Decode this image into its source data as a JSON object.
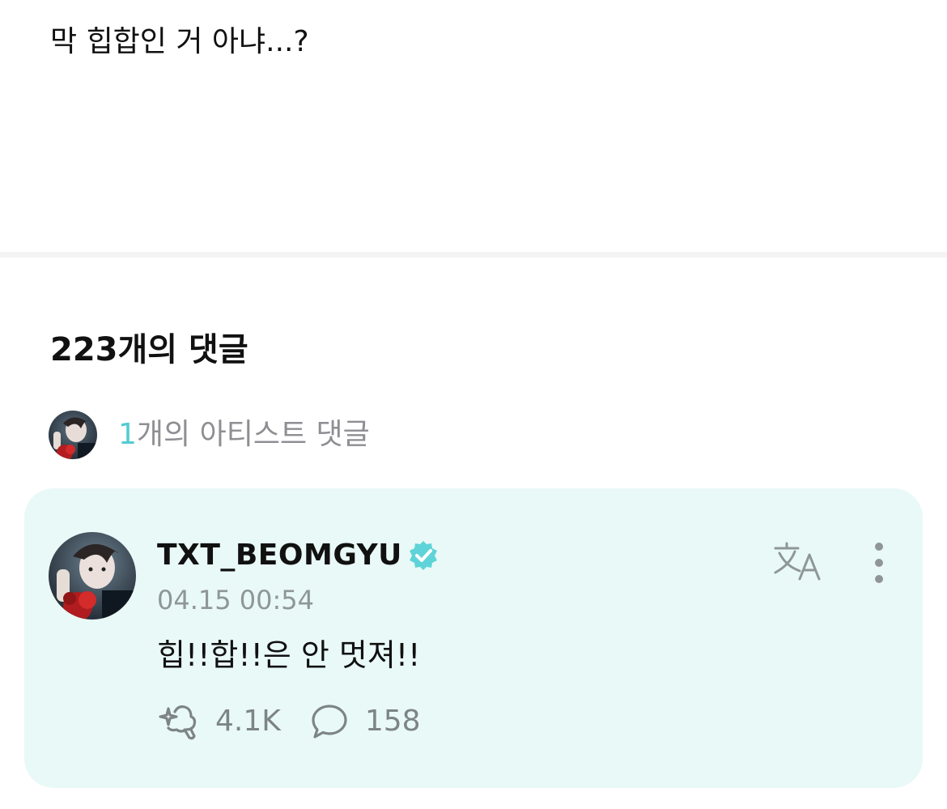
{
  "post": {
    "text": "막 힙합인 거 아냐...?"
  },
  "comments_section": {
    "heading": "223개의 댓글",
    "artist_summary": {
      "count": "1",
      "label": "개의 아티스트 댓글",
      "avatar_icon": "artist-avatar"
    }
  },
  "comment": {
    "author": "TXT_BEOMGYU",
    "verified_icon": "verified-badge-icon",
    "timestamp": "04.15 00:54",
    "body": "힙!!합!!은 안 멋져!!",
    "like_icon": "sparkle-heart-icon",
    "like_count": "4.1K",
    "reply_icon": "speech-bubble-icon",
    "reply_count": "158",
    "translate_icon": "translate-icon",
    "more_icon": "more-vertical-icon"
  },
  "colors": {
    "accent": "#52cbd2",
    "card_background": "#e9f9f7",
    "secondary_text": "#8e8e93",
    "verified_badge": "#5fd4d8"
  }
}
